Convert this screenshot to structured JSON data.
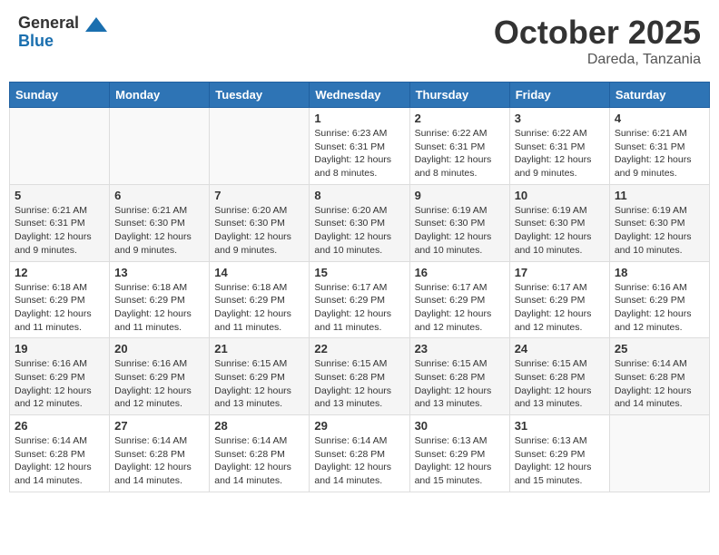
{
  "header": {
    "logo_general": "General",
    "logo_blue": "Blue",
    "month": "October 2025",
    "location": "Dareda, Tanzania"
  },
  "weekdays": [
    "Sunday",
    "Monday",
    "Tuesday",
    "Wednesday",
    "Thursday",
    "Friday",
    "Saturday"
  ],
  "weeks": [
    [
      {
        "day": "",
        "sunrise": "",
        "sunset": "",
        "daylight": ""
      },
      {
        "day": "",
        "sunrise": "",
        "sunset": "",
        "daylight": ""
      },
      {
        "day": "",
        "sunrise": "",
        "sunset": "",
        "daylight": ""
      },
      {
        "day": "1",
        "sunrise": "6:23 AM",
        "sunset": "6:31 PM",
        "daylight": "12 hours and 8 minutes."
      },
      {
        "day": "2",
        "sunrise": "6:22 AM",
        "sunset": "6:31 PM",
        "daylight": "12 hours and 8 minutes."
      },
      {
        "day": "3",
        "sunrise": "6:22 AM",
        "sunset": "6:31 PM",
        "daylight": "12 hours and 9 minutes."
      },
      {
        "day": "4",
        "sunrise": "6:21 AM",
        "sunset": "6:31 PM",
        "daylight": "12 hours and 9 minutes."
      }
    ],
    [
      {
        "day": "5",
        "sunrise": "6:21 AM",
        "sunset": "6:31 PM",
        "daylight": "12 hours and 9 minutes."
      },
      {
        "day": "6",
        "sunrise": "6:21 AM",
        "sunset": "6:30 PM",
        "daylight": "12 hours and 9 minutes."
      },
      {
        "day": "7",
        "sunrise": "6:20 AM",
        "sunset": "6:30 PM",
        "daylight": "12 hours and 9 minutes."
      },
      {
        "day": "8",
        "sunrise": "6:20 AM",
        "sunset": "6:30 PM",
        "daylight": "12 hours and 10 minutes."
      },
      {
        "day": "9",
        "sunrise": "6:19 AM",
        "sunset": "6:30 PM",
        "daylight": "12 hours and 10 minutes."
      },
      {
        "day": "10",
        "sunrise": "6:19 AM",
        "sunset": "6:30 PM",
        "daylight": "12 hours and 10 minutes."
      },
      {
        "day": "11",
        "sunrise": "6:19 AM",
        "sunset": "6:30 PM",
        "daylight": "12 hours and 10 minutes."
      }
    ],
    [
      {
        "day": "12",
        "sunrise": "6:18 AM",
        "sunset": "6:29 PM",
        "daylight": "12 hours and 11 minutes."
      },
      {
        "day": "13",
        "sunrise": "6:18 AM",
        "sunset": "6:29 PM",
        "daylight": "12 hours and 11 minutes."
      },
      {
        "day": "14",
        "sunrise": "6:18 AM",
        "sunset": "6:29 PM",
        "daylight": "12 hours and 11 minutes."
      },
      {
        "day": "15",
        "sunrise": "6:17 AM",
        "sunset": "6:29 PM",
        "daylight": "12 hours and 11 minutes."
      },
      {
        "day": "16",
        "sunrise": "6:17 AM",
        "sunset": "6:29 PM",
        "daylight": "12 hours and 12 minutes."
      },
      {
        "day": "17",
        "sunrise": "6:17 AM",
        "sunset": "6:29 PM",
        "daylight": "12 hours and 12 minutes."
      },
      {
        "day": "18",
        "sunrise": "6:16 AM",
        "sunset": "6:29 PM",
        "daylight": "12 hours and 12 minutes."
      }
    ],
    [
      {
        "day": "19",
        "sunrise": "6:16 AM",
        "sunset": "6:29 PM",
        "daylight": "12 hours and 12 minutes."
      },
      {
        "day": "20",
        "sunrise": "6:16 AM",
        "sunset": "6:29 PM",
        "daylight": "12 hours and 12 minutes."
      },
      {
        "day": "21",
        "sunrise": "6:15 AM",
        "sunset": "6:29 PM",
        "daylight": "12 hours and 13 minutes."
      },
      {
        "day": "22",
        "sunrise": "6:15 AM",
        "sunset": "6:28 PM",
        "daylight": "12 hours and 13 minutes."
      },
      {
        "day": "23",
        "sunrise": "6:15 AM",
        "sunset": "6:28 PM",
        "daylight": "12 hours and 13 minutes."
      },
      {
        "day": "24",
        "sunrise": "6:15 AM",
        "sunset": "6:28 PM",
        "daylight": "12 hours and 13 minutes."
      },
      {
        "day": "25",
        "sunrise": "6:14 AM",
        "sunset": "6:28 PM",
        "daylight": "12 hours and 14 minutes."
      }
    ],
    [
      {
        "day": "26",
        "sunrise": "6:14 AM",
        "sunset": "6:28 PM",
        "daylight": "12 hours and 14 minutes."
      },
      {
        "day": "27",
        "sunrise": "6:14 AM",
        "sunset": "6:28 PM",
        "daylight": "12 hours and 14 minutes."
      },
      {
        "day": "28",
        "sunrise": "6:14 AM",
        "sunset": "6:28 PM",
        "daylight": "12 hours and 14 minutes."
      },
      {
        "day": "29",
        "sunrise": "6:14 AM",
        "sunset": "6:28 PM",
        "daylight": "12 hours and 14 minutes."
      },
      {
        "day": "30",
        "sunrise": "6:13 AM",
        "sunset": "6:29 PM",
        "daylight": "12 hours and 15 minutes."
      },
      {
        "day": "31",
        "sunrise": "6:13 AM",
        "sunset": "6:29 PM",
        "daylight": "12 hours and 15 minutes."
      },
      {
        "day": "",
        "sunrise": "",
        "sunset": "",
        "daylight": ""
      }
    ]
  ]
}
